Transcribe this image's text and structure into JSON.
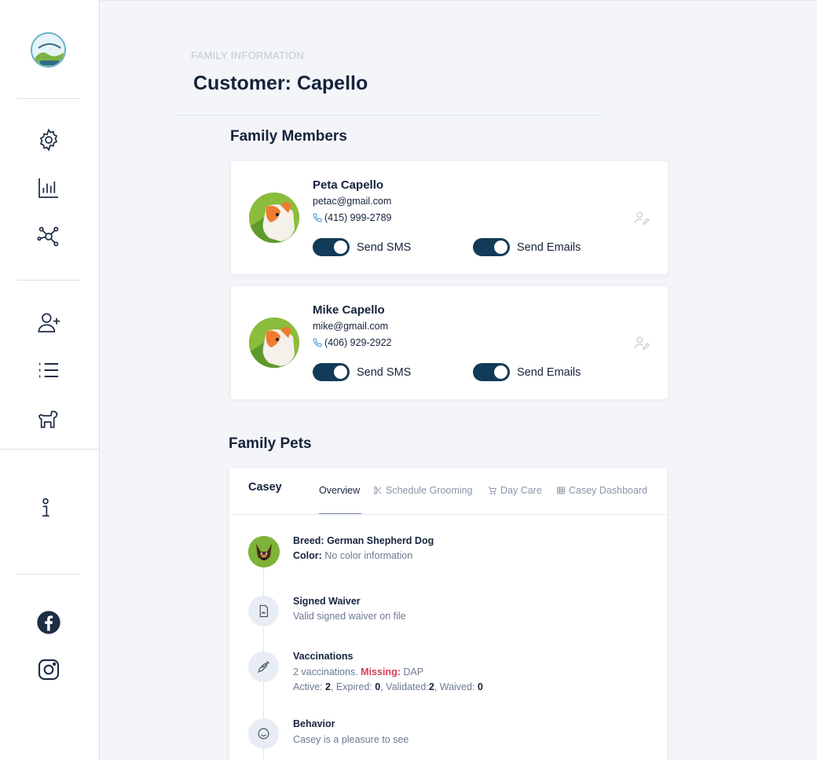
{
  "header": {
    "eyebrow": "FAMILY INFORMATION",
    "title": "Customer: Capello"
  },
  "sidebar": {
    "logo_icon": "business-logo",
    "items": [
      {
        "icon": "gear-icon"
      },
      {
        "icon": "bar-chart-icon"
      },
      {
        "icon": "network-icon"
      },
      {
        "icon": "add-user-icon"
      },
      {
        "icon": "list-icon"
      },
      {
        "icon": "dog-icon"
      },
      {
        "icon": "info-icon"
      },
      {
        "icon": "facebook-icon"
      },
      {
        "icon": "instagram-icon"
      }
    ]
  },
  "family_members": {
    "title": "Family Members",
    "members": [
      {
        "name": "Peta Capello",
        "email": "petac@gmail.com",
        "phone": "(415) 999-2789",
        "sms_label": "Send SMS",
        "sms_on": true,
        "email_label": "Send Emails",
        "email_on": true
      },
      {
        "name": "Mike Capello",
        "email": "mike@gmail.com",
        "phone": "(406) 929-2922",
        "sms_label": "Send SMS",
        "sms_on": true,
        "email_label": "Send Emails",
        "email_on": true
      }
    ]
  },
  "family_pets": {
    "title": "Family Pets",
    "pet_name": "Casey",
    "tabs": [
      {
        "label": "Overview",
        "active": true
      },
      {
        "label": "Schedule Grooming",
        "icon": "scissors-icon"
      },
      {
        "label": "Day Care",
        "icon": "cart-icon"
      },
      {
        "label": "Casey Dashboard",
        "icon": "grid-icon"
      }
    ],
    "overview": {
      "breed_label": "Breed:",
      "breed": "German Shepherd Dog",
      "color_label": "Color:",
      "color": "No color information",
      "waiver_title": "Signed Waiver",
      "waiver_text": "Valid signed waiver on file",
      "vacc_title": "Vaccinations",
      "vacc_count": "2 vaccinations.",
      "vacc_missing_label": "Missing:",
      "vacc_missing": "DAP",
      "active_label": "Active:",
      "active": "2",
      "expired_label": "Expired:",
      "expired": "0",
      "validated_label": "Validated:",
      "validated": "2",
      "waived_label": "Waived:",
      "waived": "0",
      "behavior_title": "Behavior",
      "behavior_text": "Casey is a pleasure to see"
    }
  },
  "colors": {
    "navy": "#15233b",
    "toggle": "#113b58",
    "missing": "#d43e5a",
    "muted": "#6d7b90"
  }
}
